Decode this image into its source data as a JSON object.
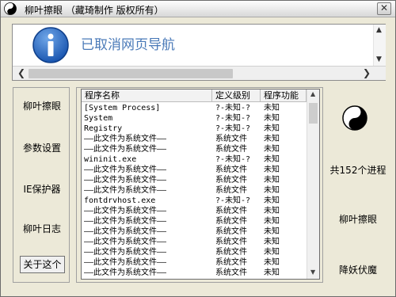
{
  "window": {
    "title": "柳叶擦眼  （藏琦制作 版权所有）",
    "close_glyph": "✕"
  },
  "banner": {
    "message": "已取消网页导航",
    "scroll_up": "▲",
    "scroll_down": "▼",
    "scroll_left": "❮",
    "scroll_right": "❯"
  },
  "nav": {
    "items": [
      "柳叶擦眼",
      "参数设置",
      "IE保护器",
      "柳叶日志"
    ],
    "about_label": "关于这个"
  },
  "process_list": {
    "columns": [
      "程序名称",
      "定义级别",
      "程序功能"
    ],
    "rows": [
      [
        "[System Process]",
        "?-未知-?",
        "未知"
      ],
      [
        "System",
        "?-未知-?",
        "未知"
      ],
      [
        "Registry",
        "?-未知-?",
        "未知"
      ],
      [
        "——此文件为系统文件——",
        "系统文件",
        "未知"
      ],
      [
        "——此文件为系统文件——",
        "系统文件",
        "未知"
      ],
      [
        "wininit.exe",
        "?-未知-?",
        "未知"
      ],
      [
        "——此文件为系统文件——",
        "系统文件",
        "未知"
      ],
      [
        "——此文件为系统文件——",
        "系统文件",
        "未知"
      ],
      [
        "——此文件为系统文件——",
        "系统文件",
        "未知"
      ],
      [
        "fontdrvhost.exe",
        "?-未知-?",
        "未知"
      ],
      [
        "——此文件为系统文件——",
        "系统文件",
        "未知"
      ],
      [
        "——此文件为系统文件——",
        "系统文件",
        "未知"
      ],
      [
        "——此文件为系统文件——",
        "系统文件",
        "未知"
      ],
      [
        "——此文件为系统文件——",
        "系统文件",
        "未知"
      ],
      [
        "——此文件为系统文件——",
        "系统文件",
        "未知"
      ],
      [
        "——此文件为系统文件——",
        "系统文件",
        "未知"
      ],
      [
        "——此文件为系统文件——",
        "系统文件",
        "未知"
      ]
    ],
    "scroll_up": "▲",
    "scroll_down": "▼"
  },
  "right": {
    "process_count": "共152个进程",
    "action_label": "柳叶擦眼",
    "slogan": "降妖伏魔"
  },
  "icons": {
    "title": "yin-yang-icon",
    "banner": "info-icon",
    "right": "yin-yang-icon"
  },
  "colors": {
    "banner_text": "#4a7ab8",
    "info_icon": "#1e5fb4"
  }
}
